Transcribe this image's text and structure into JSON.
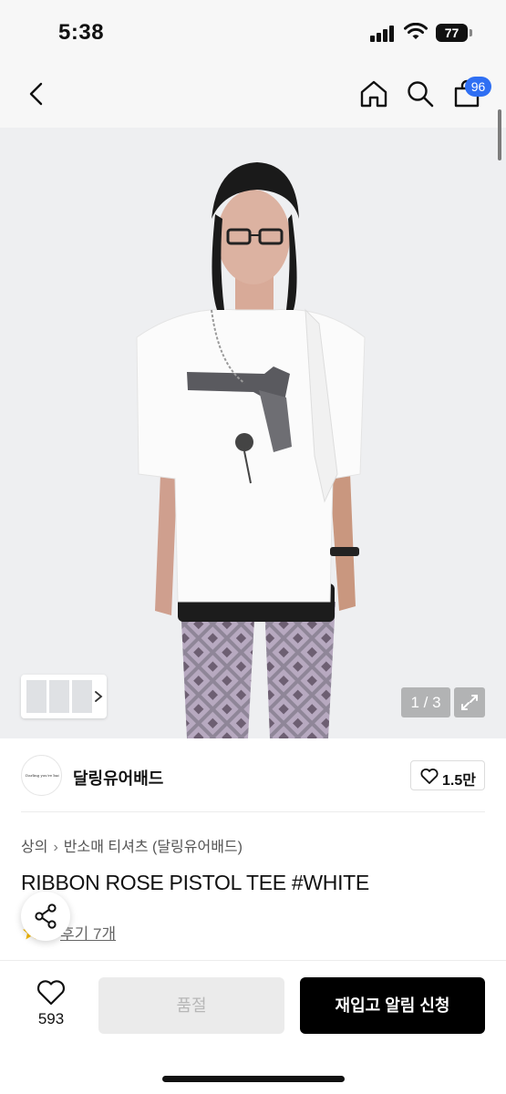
{
  "status_bar": {
    "time": "5:38",
    "battery": "77"
  },
  "nav": {
    "cart_count": "96"
  },
  "gallery": {
    "counter": "1 / 3"
  },
  "brand": {
    "name": "달링유어배드",
    "logo_text": "Darling you're bad",
    "likes": "1.5만"
  },
  "product": {
    "breadcrumb": [
      "상의",
      "반소매 티셔츠 (달링유어배드)"
    ],
    "title": "RIBBON ROSE PISTOL TEE #WHITE",
    "reviews": "후기 7개"
  },
  "bottom_bar": {
    "wish_count": "593",
    "soldout_label": "품절",
    "restock_label": "재입고 알림 신청"
  },
  "colors": {
    "accent_badge": "#2f6ff3",
    "primary_button": "#000000",
    "disabled_button": "#ebebeb"
  }
}
